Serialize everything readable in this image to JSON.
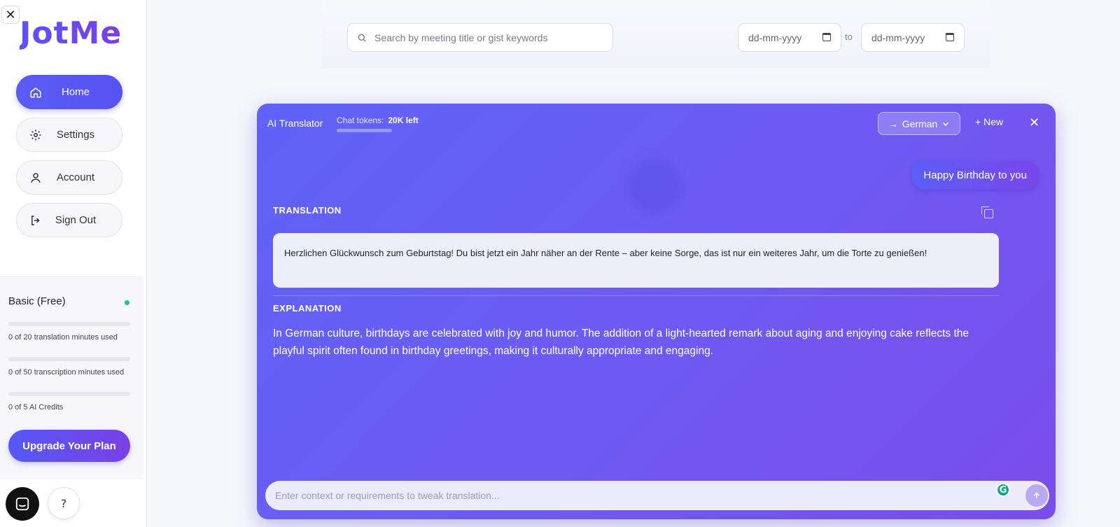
{
  "sidebar": {
    "close_symbol": "✕",
    "logo": "JotMe",
    "nav": [
      {
        "label": "Home",
        "icon": "home-icon"
      },
      {
        "label": "Settings",
        "icon": "gear-icon"
      },
      {
        "label": "Account",
        "icon": "user-icon"
      },
      {
        "label": "Sign Out",
        "icon": "sign-out-icon"
      }
    ],
    "plan": {
      "title": "Basic (Free)",
      "usage": [
        "0 of 20 translation minutes used",
        "0 of 50 transcription minutes used",
        "0 of 5 AI Credits"
      ],
      "upgrade_label": "Upgrade Your Plan"
    },
    "help_label": "?"
  },
  "filters": {
    "search_placeholder": "Search by meeting title or gist keywords",
    "date_from": "dd-mm-yyyy",
    "date_to": "dd-mm-yyyy",
    "to_label": "to"
  },
  "translator": {
    "title": "AI Translator",
    "tokens_label": "Chat tokens:",
    "tokens_value": "20K left",
    "language": "German",
    "new_label": "New",
    "close_symbol": "✕",
    "user_message": "Happy Birthday to you",
    "translation_label": "TRANSLATION",
    "translation_text": "Herzlichen Glückwunsch zum Geburtstag! Du bist jetzt ein Jahr näher an der Rente – aber keine Sorge, das ist nur ein weiteres Jahr, um die Torte zu genießen!",
    "explanation_label": "EXPLANATION",
    "explanation_text": "In German culture, birthdays are celebrated with joy and humor. The addition of a light-hearted remark about aging and enjoying cake reflects the playful spirit often found in birthday greetings, making it culturally appropriate and engaging.",
    "input_placeholder": "Enter context or requirements to tweak translation..."
  },
  "colors": {
    "accent": "#5b5cf6",
    "accent_purple": "#7b46ea",
    "status_green": "#22c38e"
  }
}
